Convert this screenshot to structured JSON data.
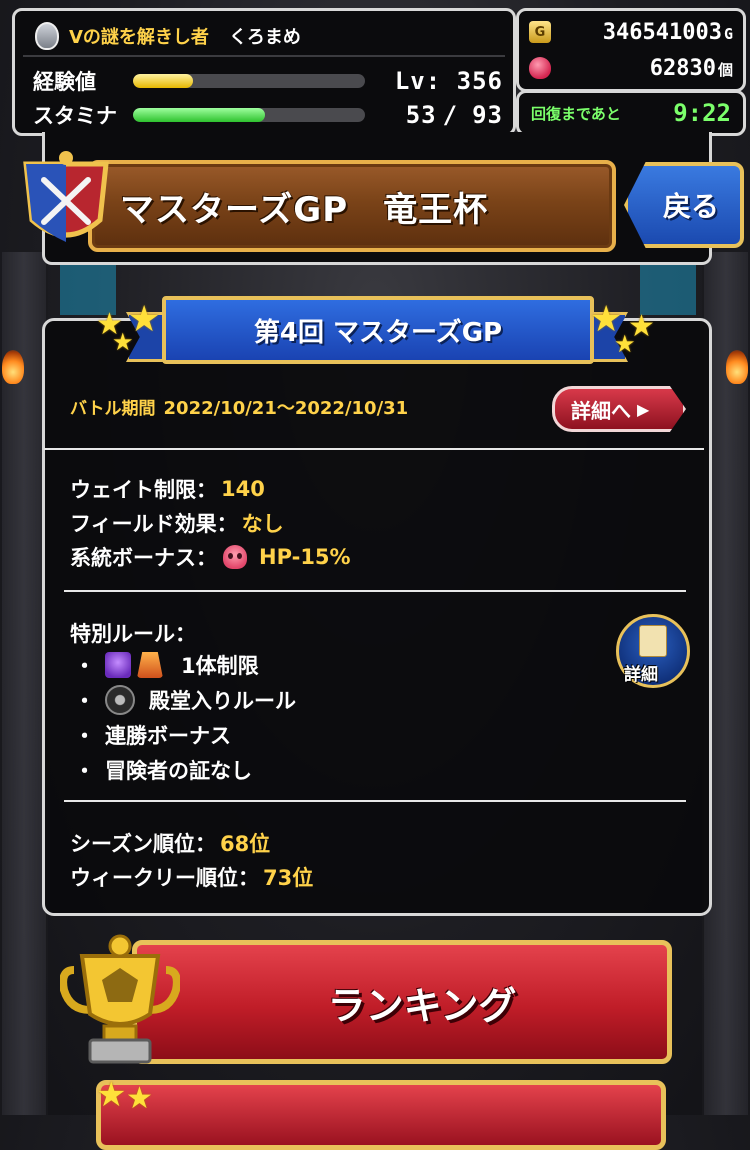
{
  "player": {
    "title": "Vの謎を解きし者",
    "name": "くろまめ"
  },
  "stats": {
    "exp_label": "経験値",
    "exp_progress": 0.26,
    "level_text": "Lv: 356",
    "stamina_label": "スタミナ",
    "stamina_current": "53",
    "stamina_separator": "/",
    "stamina_max": "93",
    "stamina_progress": 0.57
  },
  "currency": {
    "gold_value": "346541003",
    "gold_unit": "G",
    "gem_value": "62830",
    "gem_unit": "個"
  },
  "recovery": {
    "label": "回復まであと",
    "time": "9:22"
  },
  "header": {
    "title": "マスターズGP　竜王杯",
    "back_label": "戻る"
  },
  "event": {
    "round_title": "第4回 マスターズGP",
    "period_label": "バトル期間",
    "period_value": "2022/10/21〜2022/10/31",
    "detail_button": "詳細へ",
    "weight_label": "ウェイト制限：",
    "weight_value": "140",
    "field_label": "フィールド効果：",
    "field_value": "なし",
    "bonus_label": "系統ボーナス：",
    "bonus_value": "HP-15%",
    "special_rules_label": "特別ルール：",
    "rules": [
      "1体制限",
      "殿堂入りルール",
      "連勝ボーナス",
      "冒険者の証なし"
    ],
    "rules_bullet": "・",
    "rules_detail_label": "詳細",
    "season_rank_label": "シーズン順位：",
    "season_rank_value": "68位",
    "weekly_rank_label": "ウィークリー順位：",
    "weekly_rank_value": "73位"
  },
  "ranking_button": "ランキング",
  "icons": {
    "gold": "gold-bag-icon",
    "gem": "gem-icon",
    "bonus": "skull-icon",
    "rule1": [
      "purple-monster-icon",
      "orange-monster-icon"
    ],
    "rule2": "hall-of-fame-icon",
    "detail": "scroll-icon",
    "trophy": "trophy-icon"
  },
  "colors": {
    "accent_gold": "#ffd24a",
    "stamina_green": "#2ec22e",
    "recovery_green": "#7bff6b",
    "ribbon_blue": "#2f6de0",
    "button_red": "#c01d28"
  }
}
